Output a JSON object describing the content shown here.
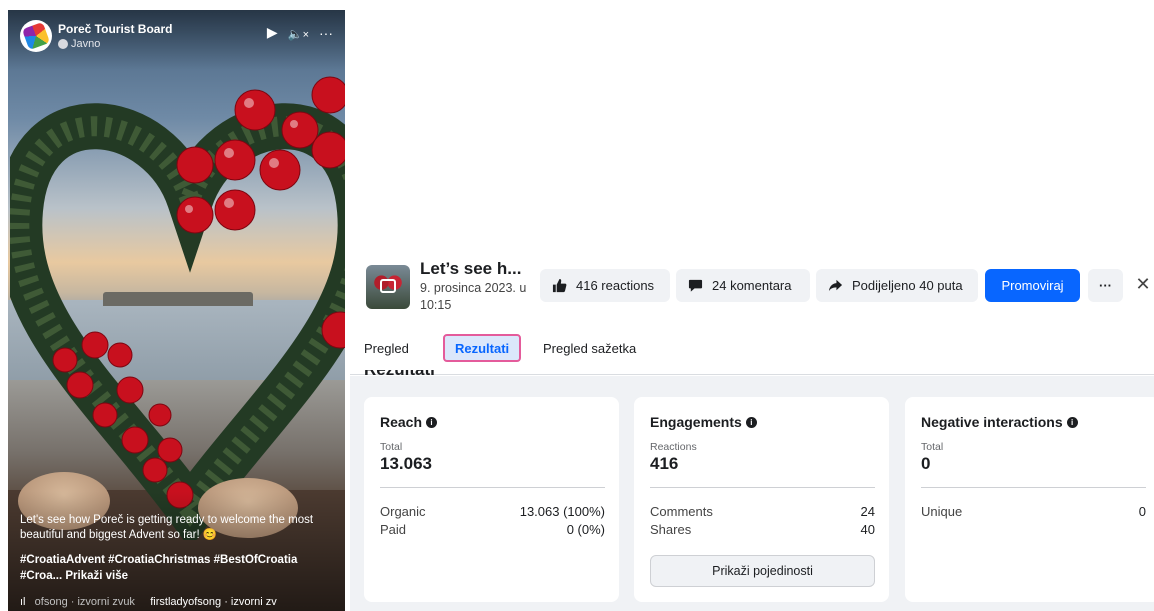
{
  "video": {
    "page_name": "Poreč Tourist Board",
    "privacy": "Javno",
    "controls": {
      "play": "▶",
      "volume": "🔈",
      "mute_mark": "×",
      "more": "···"
    },
    "caption": "Let's see how Poreč is getting ready to welcome the most beautiful and biggest Advent so far! 😊",
    "hashtags": "#CroatiaAdvent #CroatiaChristmas #BestOfCroatia #Croa...",
    "show_more": "Prikaži više",
    "audio_icon": "ıl",
    "audio_left": "ofsong · izvorni zvuk",
    "audio_right": "firstladyofsong · izvorni zv"
  },
  "post": {
    "title": "Let’s see h...",
    "date": "9. prosinca 2023. u 10:15"
  },
  "actions": {
    "reactions": "416 reactions",
    "comments": "24 komentara",
    "shares": "Podijeljeno 40 puta",
    "promote": "Promoviraj",
    "more": "···",
    "close": "✕"
  },
  "tabs": [
    {
      "label": "Pregled"
    },
    {
      "label": "Rezultati"
    },
    {
      "label": "Pregled sažetka"
    }
  ],
  "results_heading": "Rezultati",
  "cards": {
    "reach": {
      "title": "Reach",
      "sub": "Total",
      "big": "13.063",
      "rows": [
        {
          "label": "Organic",
          "value": "13.063 (100%)"
        },
        {
          "label": "Paid",
          "value": "0 (0%)"
        }
      ]
    },
    "engagements": {
      "title": "Engagements",
      "sub": "Reactions",
      "big": "416",
      "rows": [
        {
          "label": "Comments",
          "value": "24"
        },
        {
          "label": "Shares",
          "value": "40"
        }
      ],
      "details_button": "Prikaži pojedinosti"
    },
    "negative": {
      "title": "Negative interactions",
      "sub": "Total",
      "big": "0",
      "rows": [
        {
          "label": "Unique",
          "value": "0"
        }
      ]
    }
  },
  "colors": {
    "accent": "#0866ff",
    "selected_tab_border": "#e45b9b",
    "panel_bg": "#f0f2f5"
  }
}
